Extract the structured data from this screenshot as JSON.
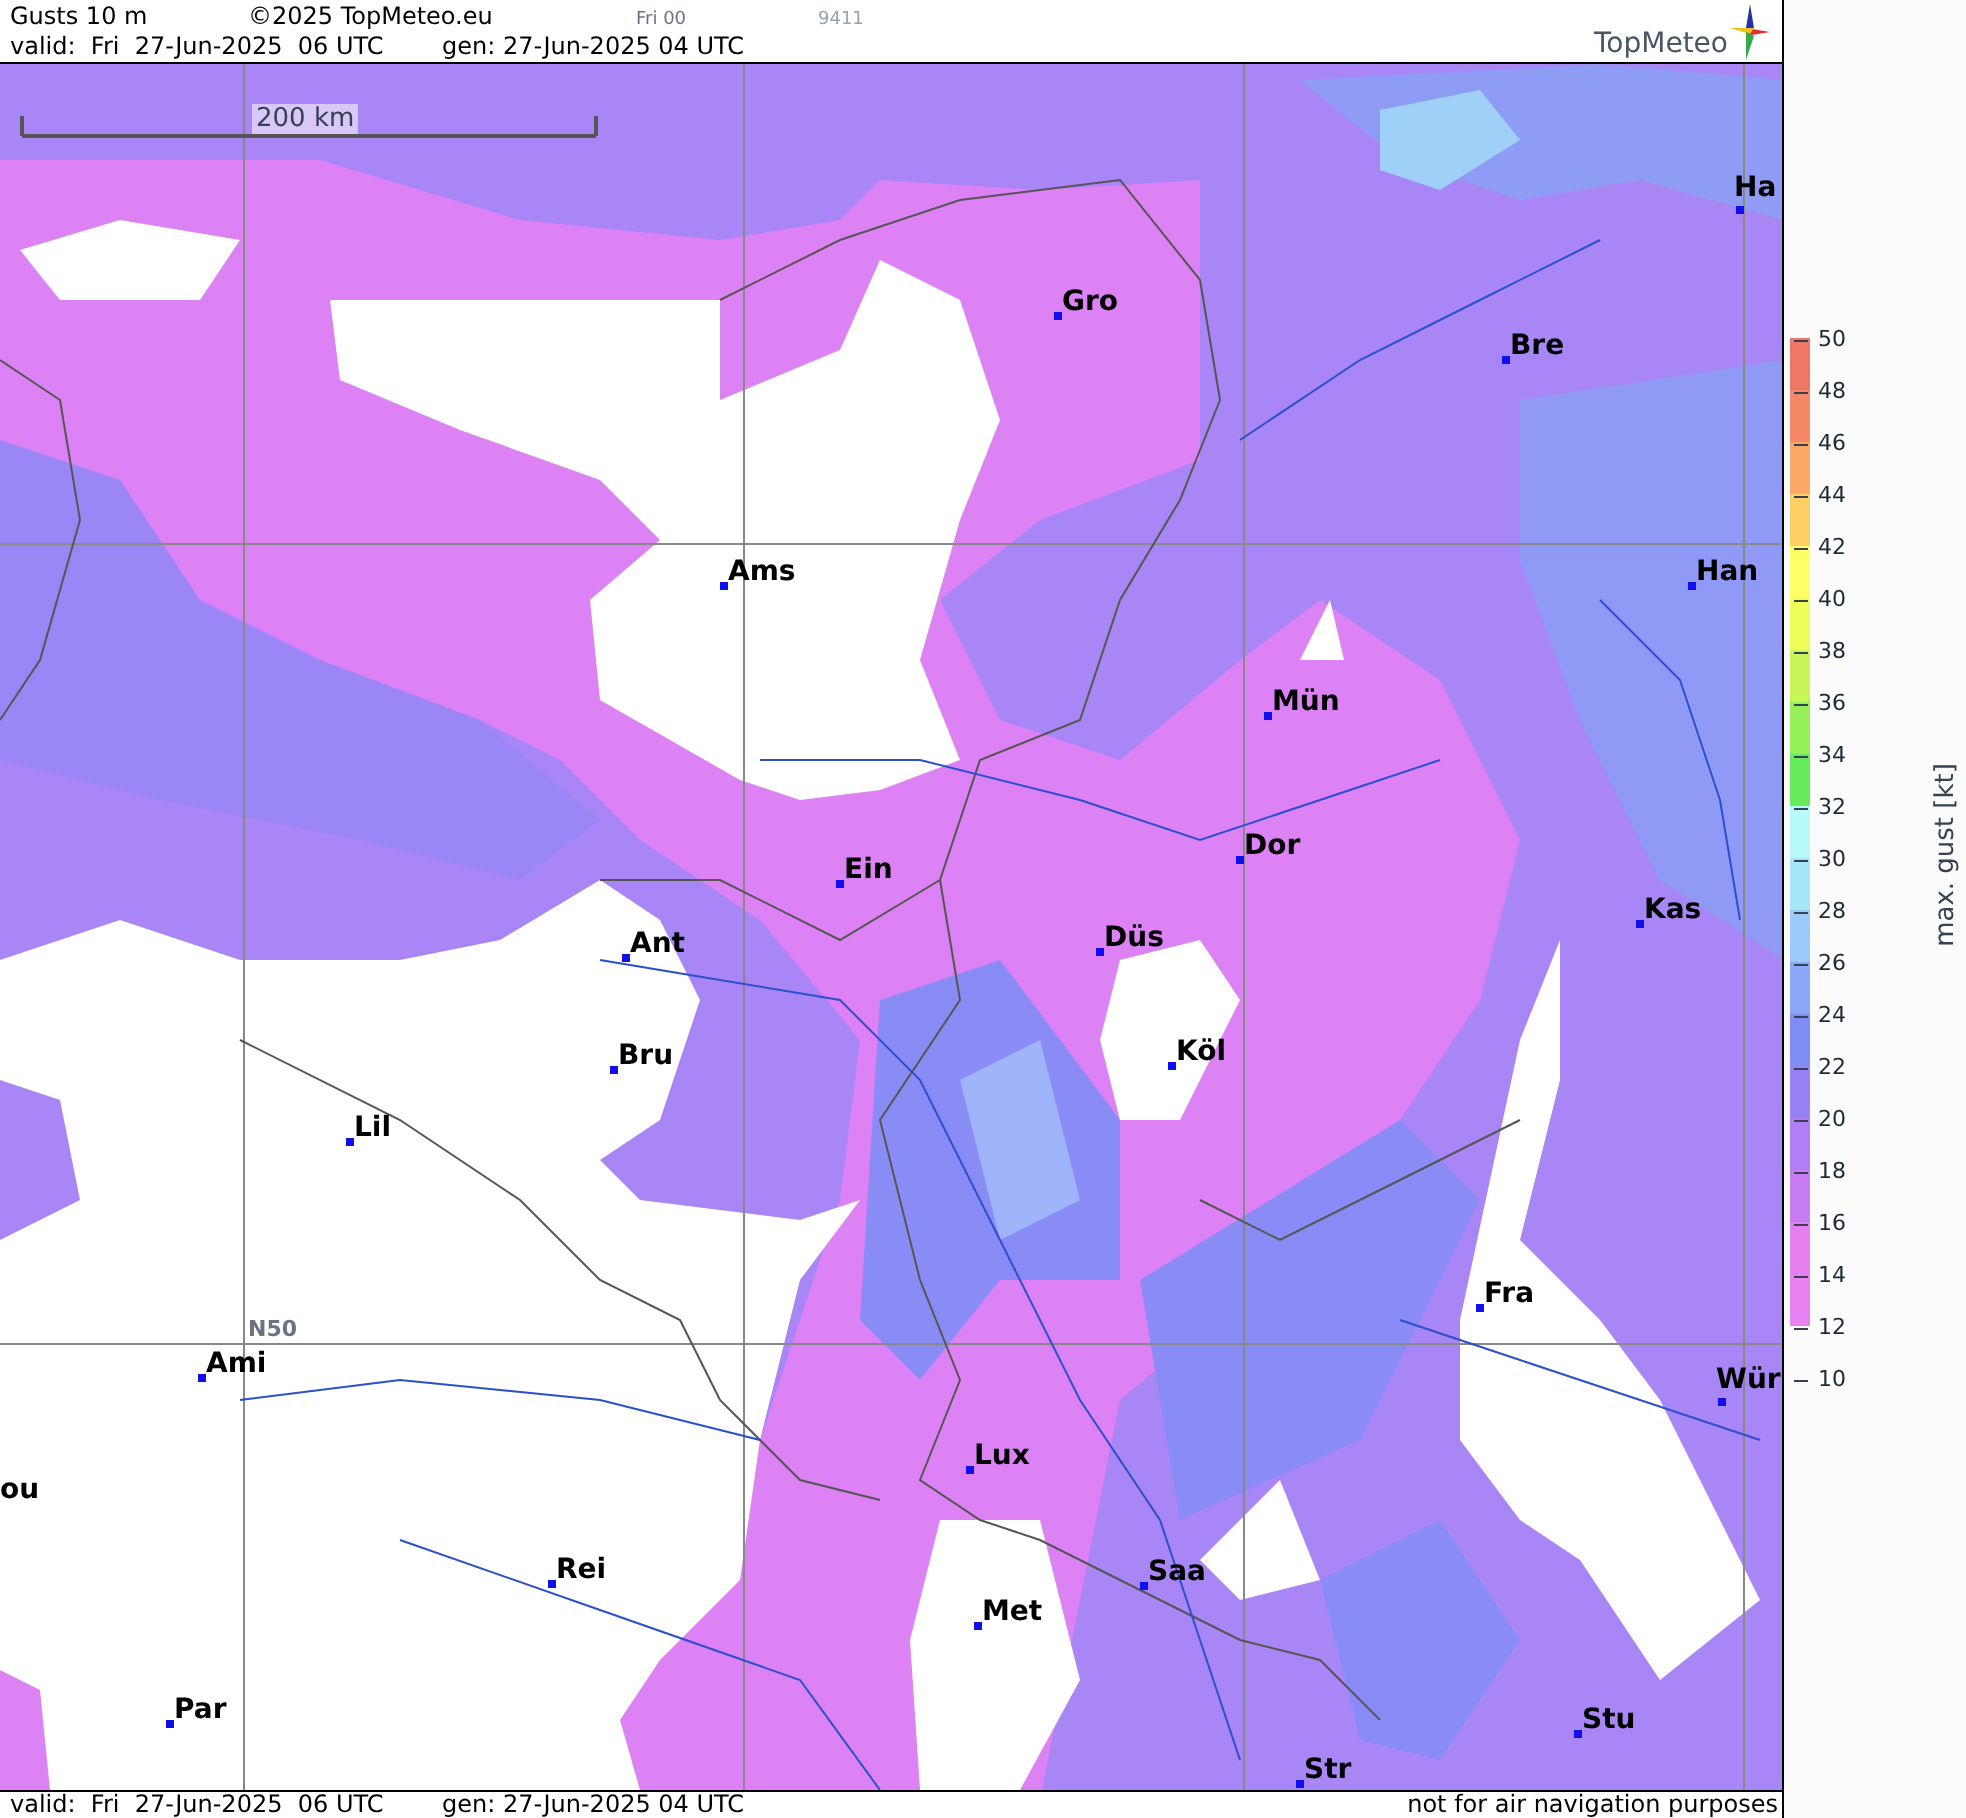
{
  "header": {
    "title": "Gusts 10 m",
    "copyright": "©2025 TopMeteo.eu",
    "run": "Fri 00",
    "code": "9411",
    "valid": "valid:  Fri  27-Jun-2025  06 UTC",
    "generated": "gen: 27-Jun-2025 04 UTC",
    "logo": "TopMeteo"
  },
  "map": {
    "scale_label": "200 km",
    "latitude_label": "N50",
    "cities": [
      {
        "name": "Ha"
      },
      {
        "name": "Gro"
      },
      {
        "name": "Bre"
      },
      {
        "name": "Ams"
      },
      {
        "name": "Han"
      },
      {
        "name": "Mün"
      },
      {
        "name": "Dor"
      },
      {
        "name": "Ein"
      },
      {
        "name": "Kas"
      },
      {
        "name": "Düs"
      },
      {
        "name": "Ant"
      },
      {
        "name": "Bru"
      },
      {
        "name": "Köl"
      },
      {
        "name": "Lil"
      },
      {
        "name": "Fra"
      },
      {
        "name": "Ami"
      },
      {
        "name": "Wür"
      },
      {
        "name": "Lux"
      },
      {
        "name": "ou"
      },
      {
        "name": "Rei"
      },
      {
        "name": "Saa"
      },
      {
        "name": "Met"
      },
      {
        "name": "Par"
      },
      {
        "name": "Stu"
      },
      {
        "name": "Str"
      }
    ]
  },
  "legend": {
    "title": "max. gust [kt]",
    "ticks": [
      "50",
      "48",
      "46",
      "44",
      "42",
      "40",
      "38",
      "36",
      "34",
      "32",
      "30",
      "28",
      "26",
      "24",
      "22",
      "20",
      "18",
      "16",
      "14",
      "12",
      "10"
    ],
    "bands": [
      {
        "color": "#ee7766"
      },
      {
        "color": "#f58866"
      },
      {
        "color": "#fba866"
      },
      {
        "color": "#fdd066"
      },
      {
        "color": "#ffff66"
      },
      {
        "color": "#eeff5a"
      },
      {
        "color": "#c8f55a"
      },
      {
        "color": "#96f05a"
      },
      {
        "color": "#66ec5a"
      },
      {
        "color": "#b8fafa"
      },
      {
        "color": "#a8e6fa"
      },
      {
        "color": "#9ccaf8"
      },
      {
        "color": "#8aa8f6"
      },
      {
        "color": "#7f8ef5"
      },
      {
        "color": "#9a80f5"
      },
      {
        "color": "#b07ef5"
      },
      {
        "color": "#c87cf3"
      },
      {
        "color": "#e47ff0"
      },
      {
        "color": "#e882f0"
      }
    ]
  },
  "footer": {
    "valid": "valid:  Fri  27-Jun-2025  06 UTC",
    "generated": "gen: 27-Jun-2025 04 UTC",
    "notice": "not for air navigation purposes"
  }
}
